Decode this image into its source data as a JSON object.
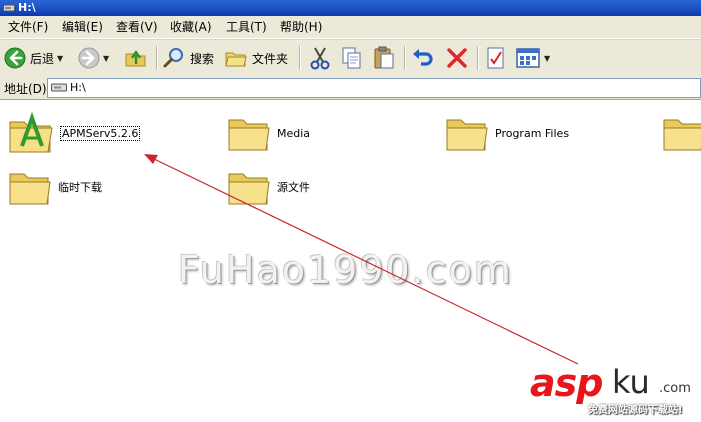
{
  "window": {
    "title": "H:\\"
  },
  "menu": {
    "file": "文件(F)",
    "edit": "编辑(E)",
    "view": "查看(V)",
    "favorites": "收藏(A)",
    "tools": "工具(T)",
    "help": "帮助(H)"
  },
  "toolbar": {
    "back_label": "后退",
    "search_label": "搜索",
    "folders_label": "文件夹"
  },
  "address": {
    "label": "地址(D)",
    "value": "H:\\"
  },
  "files": [
    {
      "name": "APMServ5.2.6",
      "icon": "apmserv-folder-icon",
      "selected": true
    },
    {
      "name": "Media",
      "icon": "folder-icon"
    },
    {
      "name": "Program Files",
      "icon": "folder-icon"
    },
    {
      "name": "",
      "icon": "folder-icon"
    },
    {
      "name": "临时下载",
      "icon": "folder-icon"
    },
    {
      "name": "源文件",
      "icon": "folder-icon"
    }
  ],
  "watermark": {
    "text": "FuHao1990.com"
  },
  "brand": {
    "asp": "asp",
    "ku": "ku",
    "com": ".com",
    "subtitle": "免费网站源码下载站!"
  },
  "annotation": {
    "arrow_color": "#c8282c"
  }
}
